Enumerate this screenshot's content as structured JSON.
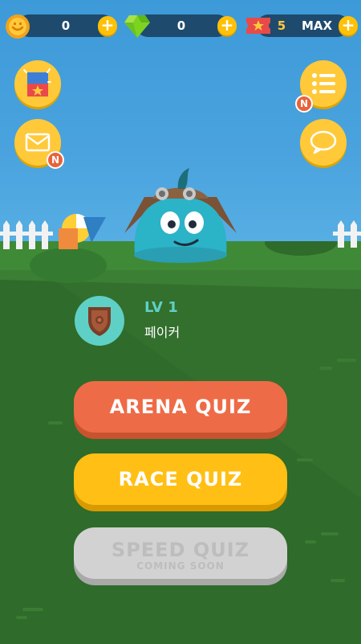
{
  "topbar": {
    "coins": "0",
    "gems": "0",
    "tickets_count": "5",
    "tickets_status": "MAX",
    "plus_symbol": "+"
  },
  "badges": {
    "new_label": "N"
  },
  "profile": {
    "level": "LV 1",
    "name": "페이커"
  },
  "buttons": {
    "arena": "ARENA QUIZ",
    "race": "RACE QUIZ",
    "speed": "SPEED QUIZ",
    "speed_sub": "COMING SOON"
  },
  "colors": {
    "sky": "#4aa3de",
    "grass": "#2f6b2a",
    "arena": "#ee6b47",
    "race": "#ffbf14",
    "disabled": "#d2d2d2",
    "accent": "#5fd0c5"
  },
  "icons": {
    "coin": "smiley-coin-icon",
    "gem": "green-gem-icon",
    "ticket": "ticket-star-icon",
    "shop": "gift-box-icon",
    "mail": "envelope-icon",
    "menu": "list-menu-icon",
    "chat": "chat-bubble-icon",
    "rank": "shield-badge-icon"
  }
}
